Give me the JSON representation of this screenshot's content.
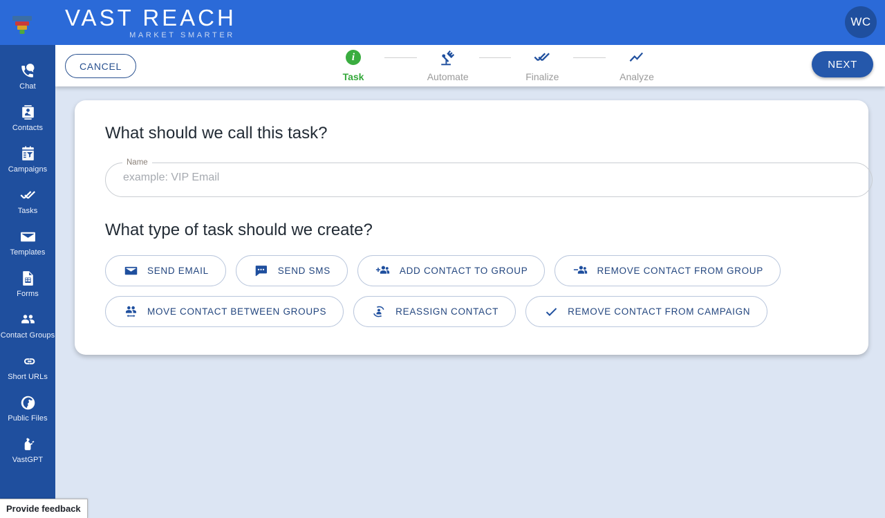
{
  "header": {
    "brand_title": "VAST REACH",
    "brand_sub": "MARKET SMARTER",
    "logo_icon": "funnel-logo-icon",
    "avatar_initials": "WC",
    "brand_blue": "#2b6ad8",
    "sidebar_blue": "#1f4f9e"
  },
  "sidebar": {
    "items": [
      {
        "label": "Chat",
        "icon": "chat-phone-icon"
      },
      {
        "label": "Contacts",
        "icon": "contact-card-icon"
      },
      {
        "label": "Campaigns",
        "icon": "campaign-calendar-icon"
      },
      {
        "label": "Tasks",
        "icon": "double-check-icon"
      },
      {
        "label": "Templates",
        "icon": "envelope-icon"
      },
      {
        "label": "Forms",
        "icon": "form-document-icon"
      },
      {
        "label": "Contact Groups",
        "icon": "people-group-icon"
      },
      {
        "label": "Short URLs",
        "icon": "link-icon"
      },
      {
        "label": "Public Files",
        "icon": "globe-icon"
      },
      {
        "label": "VastGPT",
        "icon": "vastgpt-robot-icon"
      }
    ]
  },
  "toolbar": {
    "cancel_label": "CANCEL",
    "next_label": "NEXT",
    "steps": [
      {
        "label": "Task",
        "icon": "info-circle-icon",
        "active": true
      },
      {
        "label": "Automate",
        "icon": "robot-arm-icon",
        "active": false
      },
      {
        "label": "Finalize",
        "icon": "double-check-icon",
        "active": false
      },
      {
        "label": "Analyze",
        "icon": "trend-line-icon",
        "active": false
      }
    ],
    "active_step_color": "#35a83b",
    "next_button_color": "#2558ab"
  },
  "main": {
    "question_name": "What should we call this task?",
    "name_field": {
      "label": "Name",
      "value": "",
      "placeholder": "example: VIP Email"
    },
    "question_type": "What type of task should we create?",
    "task_types": [
      {
        "label": "SEND EMAIL",
        "icon": "envelope-icon"
      },
      {
        "label": "SEND SMS",
        "icon": "sms-bubble-icon"
      },
      {
        "label": "ADD CONTACT TO GROUP",
        "icon": "person-add-group-icon"
      },
      {
        "label": "REMOVE CONTACT FROM GROUP",
        "icon": "person-remove-group-icon"
      },
      {
        "label": "MOVE CONTACT BETWEEN GROUPS",
        "icon": "people-move-icon"
      },
      {
        "label": "REASSIGN CONTACT",
        "icon": "person-reassign-icon"
      },
      {
        "label": "REMOVE CONTACT FROM CAMPAIGN",
        "icon": "check-icon"
      }
    ]
  },
  "footer": {
    "feedback_label": "Provide feedback"
  }
}
